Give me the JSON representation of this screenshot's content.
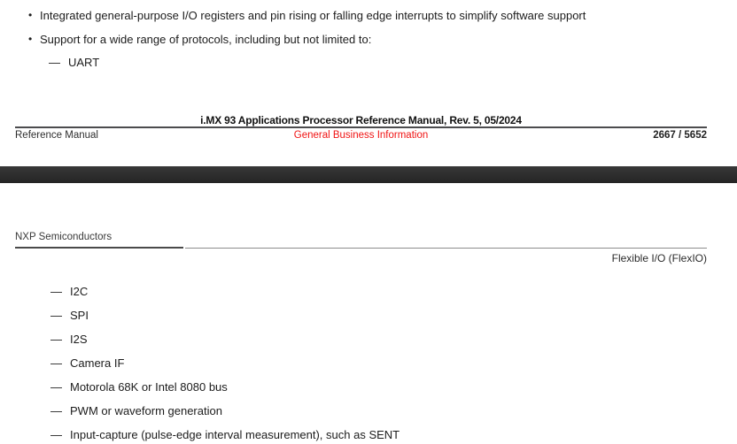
{
  "markers": {
    "bullet": "•",
    "dash": "—"
  },
  "page1": {
    "bullets": [
      "Integrated general-purpose I/O registers and pin rising or falling edge interrupts to simplify software support",
      "Support for a wide range of protocols, including but not limited to:"
    ],
    "sub_items": [
      "UART"
    ],
    "footer": {
      "title": "i.MX 93 Applications Processor Reference Manual, Rev. 5, 05/2024",
      "left": "Reference Manual",
      "center": "General Business Information",
      "right": "2667 / 5652"
    }
  },
  "page2": {
    "header_left": "NXP Semiconductors",
    "header_right": "Flexible I/O (FlexIO)",
    "items": [
      "I2C",
      "SPI",
      "I2S",
      "Camera IF",
      "Motorola 68K or Intel 8080 bus",
      "PWM or waveform generation",
      "Input-capture (pulse-edge interval measurement), such as SENT"
    ]
  },
  "colors": {
    "stamp_red": "#f01313",
    "separator_band": "#2d2d2d",
    "body_text": "#1c1c1c"
  }
}
